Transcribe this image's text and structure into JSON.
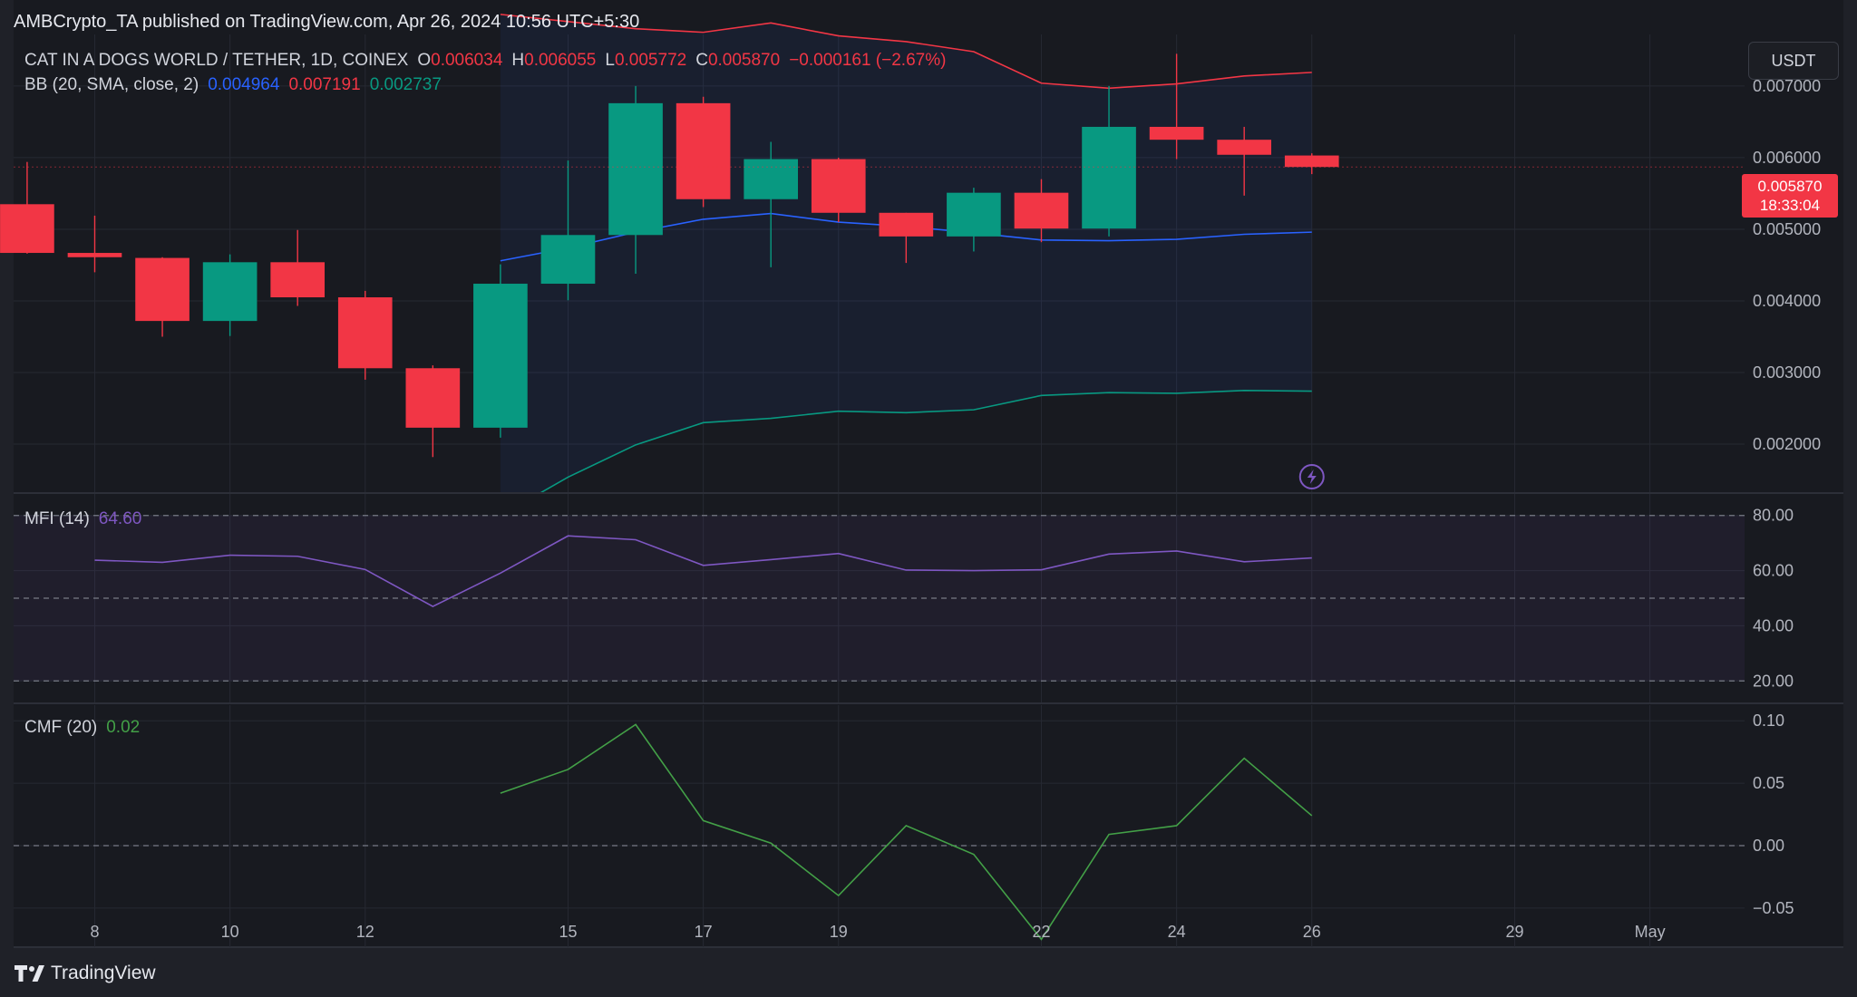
{
  "header": {
    "published": "AMBCrypto_TA published on TradingView.com, Apr 26, 2024 10:56 UTC+5:30"
  },
  "legend": {
    "symbol": "CAT IN A DOGS WORLD / TETHER, 1D, COINEX",
    "o_label": "O",
    "o_value": "0.006034",
    "h_label": "H",
    "h_value": "0.006055",
    "l_label": "L",
    "l_value": "0.005772",
    "c_label": "C",
    "c_value": "0.005870",
    "change": "−0.000161 (−2.67%)",
    "bb_label": "BB (20, SMA, close, 2)",
    "bb_basis": "0.004964",
    "bb_upper": "0.007191",
    "bb_lower": "0.002737",
    "mfi_label": "MFI (14)",
    "mfi_value": "64.60",
    "cmf_label": "CMF (20)",
    "cmf_value": "0.02"
  },
  "currency_button": "USDT",
  "price_tag": {
    "price": "0.005870",
    "countdown": "18:33:04"
  },
  "brand": "TradingView",
  "colors": {
    "up": "#089981",
    "down": "#f23645",
    "bb_basis": "#2962ff",
    "bb_upper": "#f23645",
    "bb_lower": "#089981",
    "mfi": "#7e57c2",
    "cmf": "#43a047",
    "background": "#1f2128"
  },
  "chart_data": [
    {
      "type": "candlestick",
      "title": "CAT IN A DOGS WORLD / TETHER, 1D, COINEX",
      "x_tick_labels": [
        "8",
        "10",
        "12",
        "15",
        "17",
        "19",
        "22",
        "24",
        "26",
        "29",
        "May"
      ],
      "x_tick_days": [
        8,
        10,
        12,
        15,
        17,
        19,
        22,
        24,
        26,
        29,
        31
      ],
      "y_tick_labels": [
        "0.007000",
        "0.006000",
        "0.005000",
        "0.004000",
        "0.003000",
        "0.002000"
      ],
      "y_ticks": [
        0.007,
        0.006,
        0.005,
        0.004,
        0.003,
        0.002
      ],
      "ylim": [
        0.00133,
        0.00772
      ],
      "xlim": [
        6.8,
        32.4
      ],
      "candles": [
        {
          "day": 7,
          "open": 0.00535,
          "high": 0.00594,
          "low": 0.00466,
          "close": 0.00467
        },
        {
          "day": 8,
          "open": 0.00467,
          "high": 0.00519,
          "low": 0.0044,
          "close": 0.00461
        },
        {
          "day": 9,
          "open": 0.0046,
          "high": 0.00461,
          "low": 0.0035,
          "close": 0.00372
        },
        {
          "day": 10,
          "open": 0.00372,
          "high": 0.00465,
          "low": 0.00351,
          "close": 0.00454
        },
        {
          "day": 11,
          "open": 0.00454,
          "high": 0.00499,
          "low": 0.00393,
          "close": 0.00405
        },
        {
          "day": 12,
          "open": 0.00405,
          "high": 0.00414,
          "low": 0.0029,
          "close": 0.00306
        },
        {
          "day": 13,
          "open": 0.00306,
          "high": 0.0031,
          "low": 0.00182,
          "close": 0.00223
        },
        {
          "day": 14,
          "open": 0.00223,
          "high": 0.00451,
          "low": 0.00209,
          "close": 0.00424
        },
        {
          "day": 15,
          "open": 0.00424,
          "high": 0.00596,
          "low": 0.00401,
          "close": 0.00492
        },
        {
          "day": 16,
          "open": 0.00492,
          "high": 0.007,
          "low": 0.00438,
          "close": 0.00676
        },
        {
          "day": 17,
          "open": 0.00676,
          "high": 0.00685,
          "low": 0.00531,
          "close": 0.00542
        },
        {
          "day": 18,
          "open": 0.00542,
          "high": 0.00622,
          "low": 0.00447,
          "close": 0.00598
        },
        {
          "day": 19,
          "open": 0.00598,
          "high": 0.006,
          "low": 0.0051,
          "close": 0.00523
        },
        {
          "day": 20,
          "open": 0.00523,
          "high": 0.00523,
          "low": 0.00453,
          "close": 0.0049
        },
        {
          "day": 21,
          "open": 0.0049,
          "high": 0.00558,
          "low": 0.00469,
          "close": 0.00551
        },
        {
          "day": 22,
          "open": 0.00551,
          "high": 0.0057,
          "low": 0.00482,
          "close": 0.00501
        },
        {
          "day": 23,
          "open": 0.00501,
          "high": 0.007,
          "low": 0.0049,
          "close": 0.00643
        },
        {
          "day": 24,
          "open": 0.00643,
          "high": 0.00745,
          "low": 0.00598,
          "close": 0.00625
        },
        {
          "day": 25,
          "open": 0.00625,
          "high": 0.00643,
          "low": 0.00547,
          "close": 0.00604
        },
        {
          "day": 26,
          "open": 0.00603,
          "high": 0.00606,
          "low": 0.00577,
          "close": 0.00587
        }
      ],
      "bollinger": {
        "name": "BB (20, SMA, close, 2)",
        "days": [
          14,
          15,
          16,
          17,
          18,
          19,
          20,
          21,
          22,
          23,
          24,
          25,
          26
        ],
        "basis": [
          0.00456,
          0.00474,
          0.00496,
          0.00514,
          0.00522,
          0.0051,
          0.00504,
          0.00495,
          0.00485,
          0.00484,
          0.00486,
          0.00493,
          0.00496
        ],
        "upper": [
          0.008,
          0.0079,
          0.0078,
          0.00775,
          0.00788,
          0.0077,
          0.00762,
          0.00748,
          0.00704,
          0.00697,
          0.00703,
          0.00714,
          0.00719
        ],
        "lower": [
          0.001,
          0.00154,
          0.00199,
          0.0023,
          0.00236,
          0.00246,
          0.00244,
          0.00248,
          0.00268,
          0.00272,
          0.00271,
          0.00275,
          0.00274
        ]
      },
      "last_price": 0.00587
    },
    {
      "type": "line",
      "title": "MFI (14)",
      "y_tick_labels": [
        "80.00",
        "60.00",
        "40.00",
        "20.00"
      ],
      "y_ticks": [
        80,
        60,
        40,
        20
      ],
      "ylim": [
        12.2,
        87.8
      ],
      "bands": [
        80,
        50,
        20
      ],
      "series": [
        {
          "name": "MFI (14)",
          "days": [
            8,
            9,
            10,
            11,
            12,
            13,
            14,
            15,
            16,
            17,
            18,
            19,
            20,
            21,
            22,
            23,
            24,
            25,
            26
          ],
          "values": [
            63.8,
            63.0,
            65.6,
            65.2,
            60.4,
            47.0,
            59.1,
            72.6,
            71.2,
            61.9,
            64.0,
            66.2,
            60.2,
            60.0,
            60.3,
            66.0,
            67.1,
            63.2,
            64.6
          ]
        }
      ]
    },
    {
      "type": "line",
      "title": "CMF (20)",
      "y_tick_labels": [
        "0.10",
        "0.05",
        "0.00",
        "−0.05"
      ],
      "y_ticks": [
        0.1,
        0.05,
        0.0,
        -0.05
      ],
      "ylim": [
        -0.0813,
        0.1125
      ],
      "zero_line": 0,
      "series": [
        {
          "name": "CMF (20)",
          "days": [
            14,
            15,
            16,
            17,
            18,
            19,
            20,
            21,
            22,
            23,
            24,
            25,
            26
          ],
          "values": [
            0.042,
            0.061,
            0.097,
            0.02,
            0.002,
            -0.04,
            0.016,
            -0.007,
            -0.075,
            0.009,
            0.016,
            0.07,
            0.024
          ]
        }
      ]
    }
  ]
}
